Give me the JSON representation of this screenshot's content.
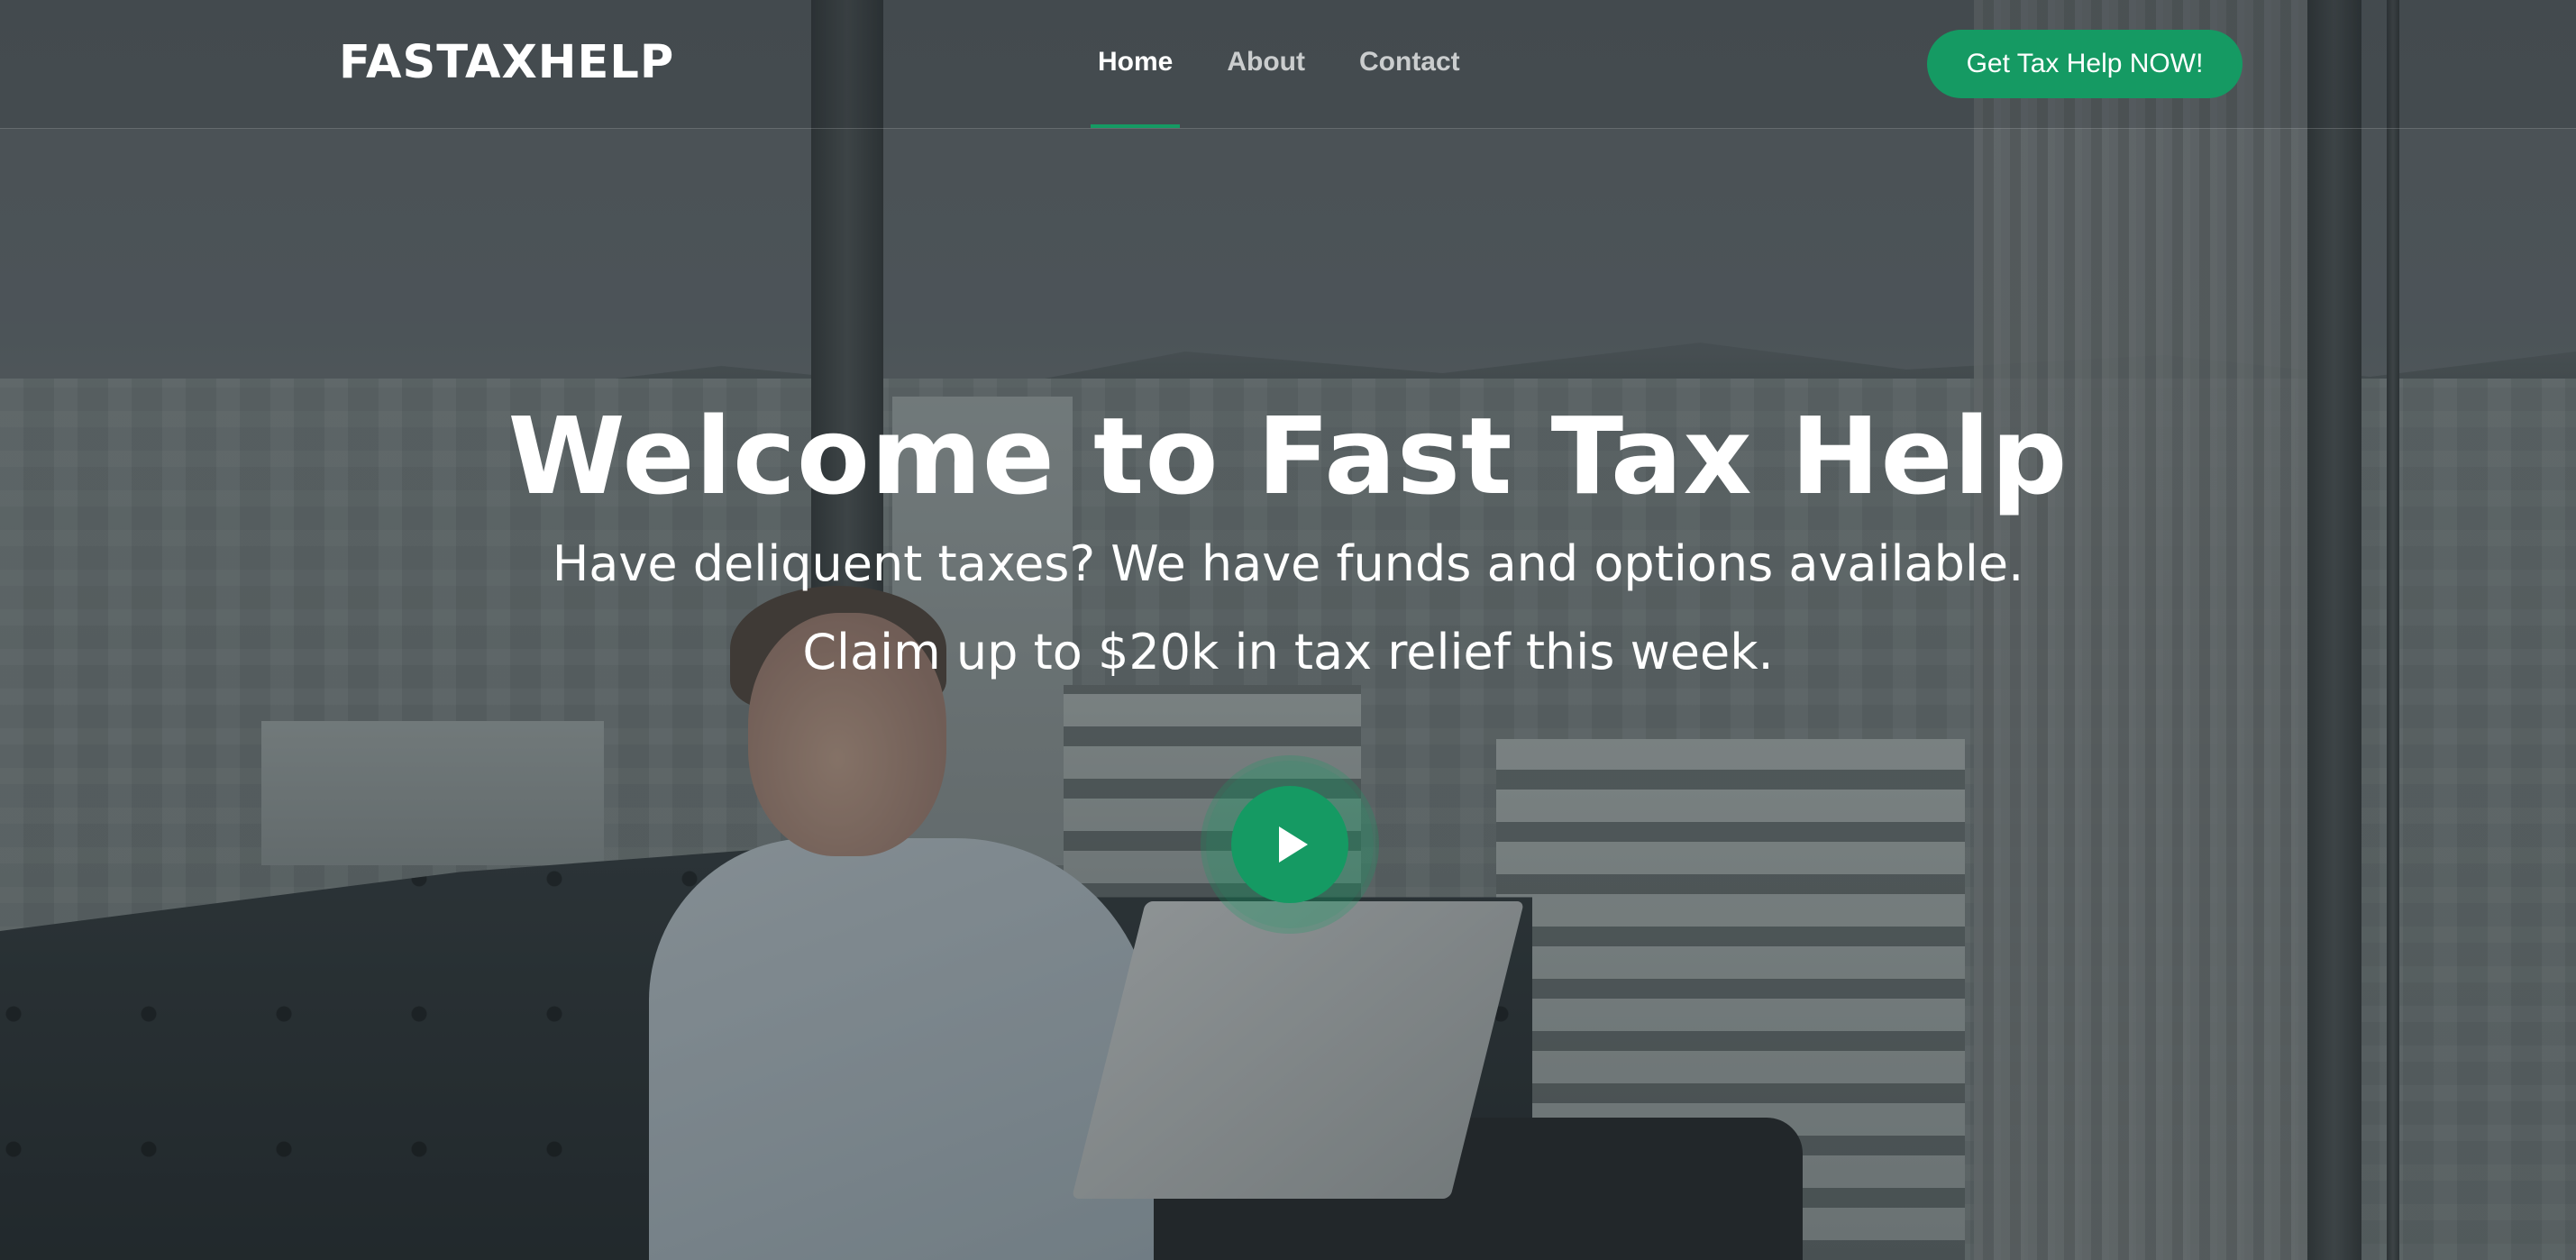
{
  "header": {
    "logo": "FASTAXHELP",
    "nav": [
      {
        "label": "Home",
        "active": true
      },
      {
        "label": "About",
        "active": false
      },
      {
        "label": "Contact",
        "active": false
      }
    ],
    "cta_label": "Get Tax Help NOW!"
  },
  "hero": {
    "title": "Welcome to Fast Tax Help",
    "subtitle": "Have deliquent taxes? We have funds and options available.",
    "claim": "Claim up to $20k in tax relief this week."
  },
  "colors": {
    "accent": "#159a63",
    "overlay": "#1a2022"
  },
  "icons": {
    "play": "play-icon"
  }
}
